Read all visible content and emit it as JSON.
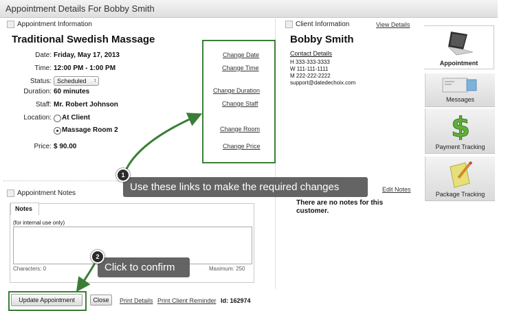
{
  "window": {
    "title": "Appointment Details For Bobby Smith"
  },
  "appointment": {
    "section_label": "Appointment Information",
    "service": "Traditional Swedish Massage",
    "fields": {
      "date_label": "Date:",
      "date": "Friday, May 17, 2013",
      "time_label": "Time:",
      "time": "12:00 PM - 1:00 PM",
      "status_label": "Status:",
      "status": "Scheduled",
      "duration_label": "Duration:",
      "duration": "60 minutes",
      "staff_label": "Staff:",
      "staff": "Mr. Robert Johnson",
      "location_label": "Location:",
      "location_option_1": "At Client",
      "location_option_2": "Massage Room 2",
      "price_label": "Price:",
      "price": "$ 90.00"
    },
    "links": {
      "change_date": "Change Date",
      "change_time": "Change Time",
      "change_duration": "Change Duration",
      "change_staff": "Change Staff",
      "change_room": "Change Room",
      "change_price": "Change Price"
    }
  },
  "client": {
    "section_label": "Client Information",
    "view_details": "View Details",
    "name": "Bobby Smith",
    "contact_heading": "Contact Details",
    "phone_home": "H  333-333-3333",
    "phone_work": "W  111-111-1111",
    "phone_mobile": "M  222-222-2222",
    "email": "support@datedechoix.com"
  },
  "notes": {
    "section_label": "Appointment Notes",
    "tab_label": "Notes",
    "hint": "(for internal use only)",
    "characters": "Characters: 0",
    "maximum": "Maximum:  250",
    "edit_notes": "Edit Notes",
    "client_notes": "There are no notes for this customer."
  },
  "footer": {
    "update_button": "Update Appointment",
    "close_button": "Close",
    "print_details": "Print Details",
    "print_reminder": "Print Client Reminder",
    "id_text": "Id: 162974"
  },
  "sidebar_tabs": [
    {
      "label": "Appointment",
      "icon": "laptop-icon"
    },
    {
      "label": "Messages",
      "icon": "envelope-icon"
    },
    {
      "label": "Payment Tracking",
      "icon": "dollar-icon"
    },
    {
      "label": "Package Tracking",
      "icon": "package-icon"
    }
  ],
  "callouts": {
    "one_number": "1",
    "one_text": "Use these links to make the required changes",
    "two_number": "2",
    "two_text": "Click to confirm"
  },
  "colors": {
    "highlight_green": "#3a7e36",
    "callout_bg": "#585858",
    "dollar_green": "#5fae3c"
  }
}
